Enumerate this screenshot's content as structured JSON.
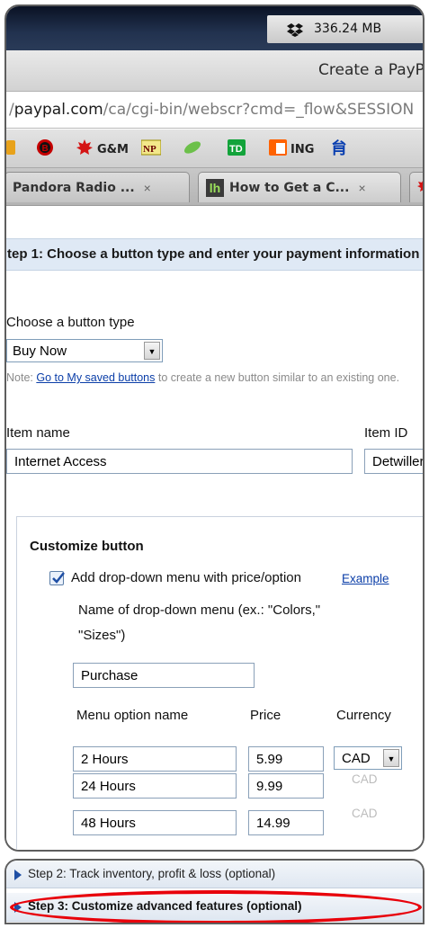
{
  "os_menubar": {
    "memory_text": "336.24 MB"
  },
  "window": {
    "title": "Create a PayPal Button"
  },
  "address_bar": {
    "url_domain": "paypal.com",
    "url_prefix": "/",
    "url_rest": "/ca/cgi-bin/webscr?cmd=_flow&SESSION"
  },
  "bookmarks": [
    {
      "name": "bookmark-cbc",
      "label": "",
      "icon": "cbc-icon"
    },
    {
      "name": "bookmark-b",
      "label": "",
      "icon": "b-circle-icon"
    },
    {
      "name": "bookmark-gm",
      "label": "G&M",
      "icon": "maple-leaf-icon"
    },
    {
      "name": "bookmark-np",
      "label": "",
      "icon": "np-icon"
    },
    {
      "name": "bookmark-leaf",
      "label": "",
      "icon": "green-leaf-icon"
    },
    {
      "name": "bookmark-td",
      "label": "",
      "icon": "td-icon"
    },
    {
      "name": "bookmark-ing",
      "label": "ING",
      "icon": "ing-lion-icon"
    },
    {
      "name": "bookmark-chinese",
      "label": "",
      "icon": "chinese-char-icon"
    }
  ],
  "tabs": [
    {
      "label": "Pandora Radio ...",
      "close": "×"
    },
    {
      "label": "How to Get a C...",
      "close": "×"
    }
  ],
  "step1": {
    "header": "tep 1: Choose a button type and enter your payment information"
  },
  "button_type": {
    "label": "Choose a button type",
    "value": "Buy Now"
  },
  "note": {
    "prefix": "Note: ",
    "link": "Go to My saved buttons",
    "suffix": " to create a new button similar to an existing one."
  },
  "item": {
    "name_label": "Item name",
    "name_value": "Internet Access",
    "id_label": "Item ID",
    "id_value": "Detwiller"
  },
  "customize": {
    "title": "Customize button",
    "dropdown_checkbox_label": "Add drop-down menu with price/option",
    "example_link": "Example",
    "menu_name_label_line1": "Name of drop-down menu (ex.: \"Colors,\"",
    "menu_name_label_line2": "\"Sizes\")",
    "menu_name_value": "Purchase",
    "col_option": "Menu option name",
    "col_price": "Price",
    "col_currency": "Currency",
    "options": [
      {
        "name": "2 Hours",
        "price": "5.99",
        "currency": "CAD"
      },
      {
        "name": "24 Hours",
        "price": "9.99",
        "currency": "CAD"
      },
      {
        "name": "48 Hours",
        "price": "14.99",
        "currency": "CAD"
      }
    ]
  },
  "accordion": {
    "step2": "Step 2: Track inventory, profit & loss (optional)",
    "step3": "Step 3: Customize advanced features (optional)"
  },
  "colors": {
    "highlight_ellipse": "#e8000a",
    "link": "#0b3ea8",
    "step_header_bg": "#dfe9f5"
  }
}
